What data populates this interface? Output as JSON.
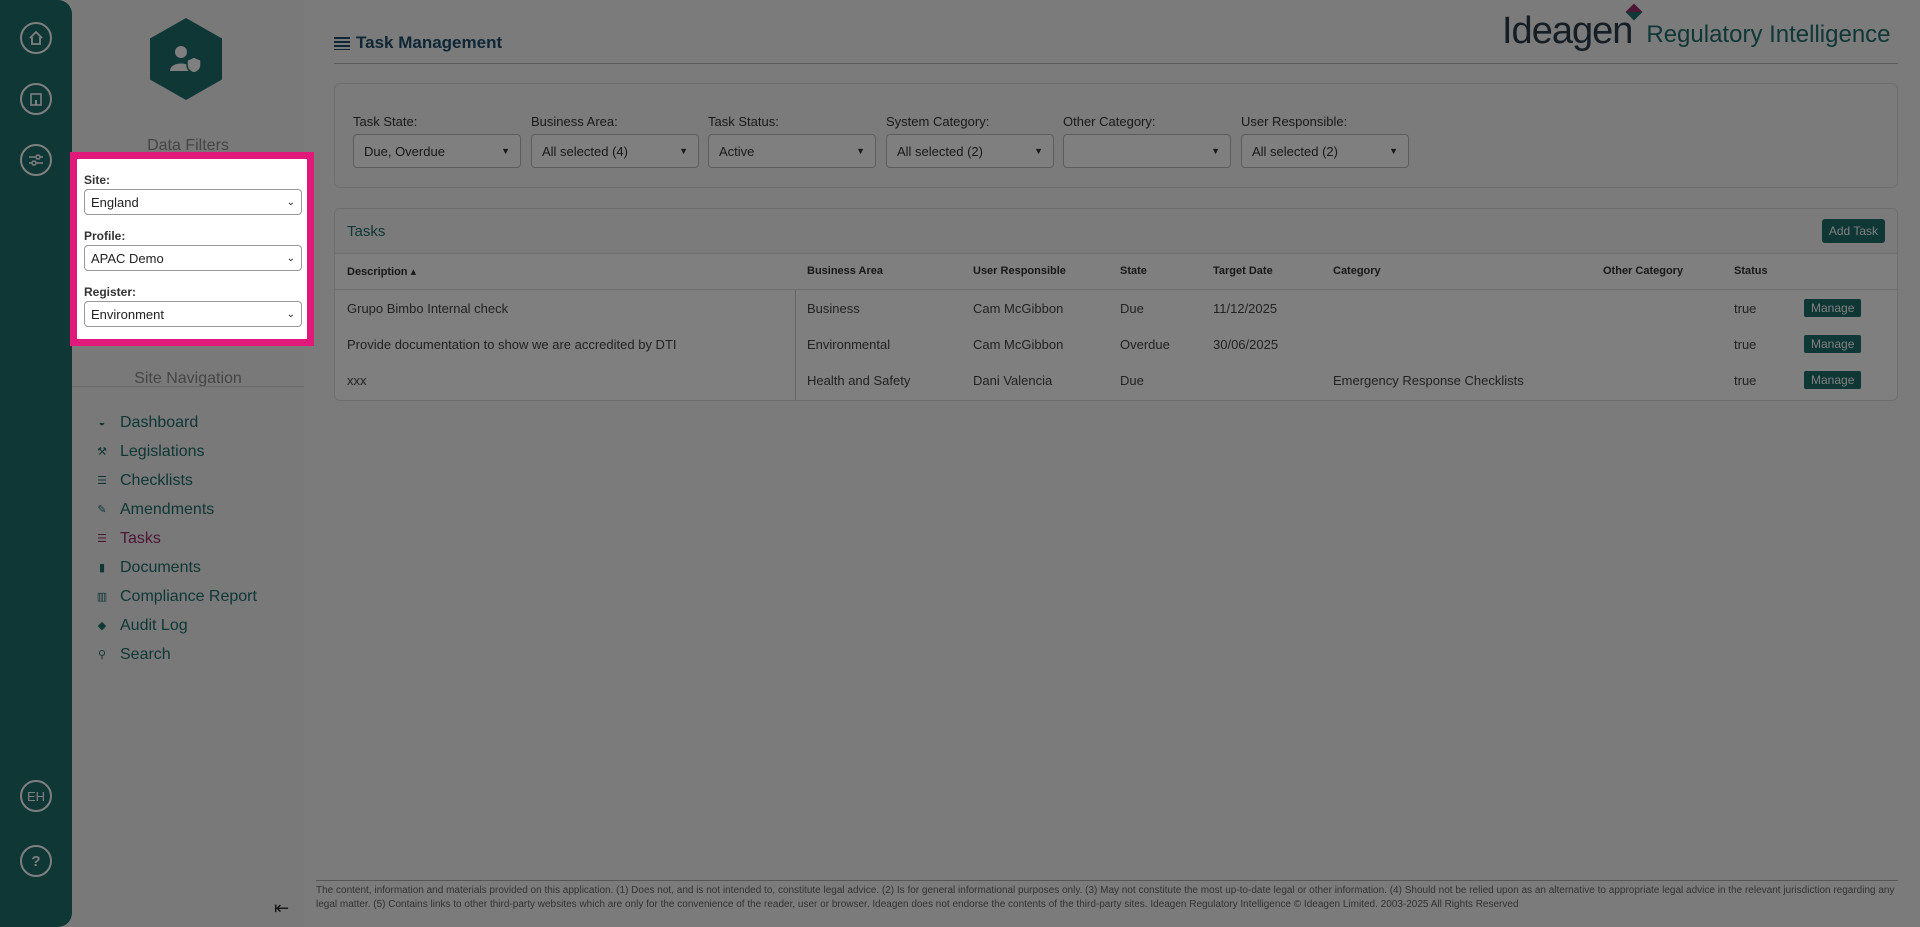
{
  "rail": {
    "home_icon": "home-icon",
    "building_icon": "building-icon",
    "settings_icon": "sliders-icon",
    "user_initials": "EH",
    "help_label": "?"
  },
  "sidebar": {
    "data_filters_title": "Data Filters",
    "site_navigation_title": "Site Navigation",
    "filters": {
      "site_label": "Site:",
      "site_value": "England",
      "profile_label": "Profile:",
      "profile_value": "APAC Demo",
      "register_label": "Register:",
      "register_value": "Environment"
    },
    "nav_items": [
      {
        "label": "Dashboard",
        "icon": "dashboard-icon"
      },
      {
        "label": "Legislations",
        "icon": "gavel-icon"
      },
      {
        "label": "Checklists",
        "icon": "list-icon"
      },
      {
        "label": "Amendments",
        "icon": "edit-icon"
      },
      {
        "label": "Tasks",
        "icon": "tasks-icon",
        "active": true
      },
      {
        "label": "Documents",
        "icon": "document-icon"
      },
      {
        "label": "Compliance Report",
        "icon": "chart-icon"
      },
      {
        "label": "Audit Log",
        "icon": "tags-icon"
      },
      {
        "label": "Search",
        "icon": "search-icon"
      }
    ],
    "collapse_icon": "collapse-left-icon"
  },
  "header": {
    "page_title": "Task Management",
    "brand_name": "Ideagen",
    "brand_product": "Regulatory Intelligence"
  },
  "filters": {
    "task_state": {
      "label": "Task State:",
      "value": "Due, Overdue"
    },
    "business_area": {
      "label": "Business Area:",
      "value": "All selected (4)"
    },
    "task_status": {
      "label": "Task Status:",
      "value": "Active"
    },
    "system_category": {
      "label": "System Category:",
      "value": "All selected (2)"
    },
    "other_category": {
      "label": "Other Category:",
      "value": ""
    },
    "user_responsible": {
      "label": "User Responsible:",
      "value": "All selected (2)"
    }
  },
  "tasks": {
    "title": "Tasks",
    "add_label": "Add Task",
    "columns": {
      "description": "Description ▴",
      "business_area": "Business Area",
      "user_responsible": "User Responsible",
      "state": "State",
      "target_date": "Target Date",
      "category": "Category",
      "other_category": "Other Category",
      "status": "Status"
    },
    "rows": [
      {
        "description": "Grupo Bimbo Internal check",
        "business_area": "Business",
        "user": "Cam McGibbon",
        "state": "Due",
        "target_date": "11/12/2025",
        "category": "",
        "other_category": "",
        "status": "true",
        "action": "Manage"
      },
      {
        "description": "Provide documentation to show we are accredited by DTI",
        "business_area": "Environmental",
        "user": "Cam McGibbon",
        "state": "Overdue",
        "target_date": "30/06/2025",
        "category": "",
        "other_category": "",
        "status": "true",
        "action": "Manage"
      },
      {
        "description": "xxx",
        "business_area": "Health and Safety",
        "user": "Dani Valencia",
        "state": "Due",
        "target_date": "",
        "category": "Emergency Response Checklists",
        "other_category": "",
        "status": "true",
        "action": "Manage"
      }
    ]
  },
  "footer": {
    "disclaimer": "The content, information and materials provided on this application. (1) Does not, and is not intended to, constitute legal advice. (2) Is for general informational purposes only. (3) May not constitute the most up-to-date legal or other information. (4) Should not be relied upon as an alternative to appropriate legal advice in the relevant jurisdiction regarding any legal matter. (5) Contains links to other third-party websites which are only for the convenience of the reader, user or browser. Ideagen does not endorse the contents of the third-party sites. Ideagen Regulatory Intelligence © Ideagen Limited. 2003-2025 All Rights Reserved"
  },
  "colors": {
    "brand_teal": "#1d6f6c",
    "highlight_pink": "#e0197b",
    "active_nav": "#9b2d6b"
  }
}
